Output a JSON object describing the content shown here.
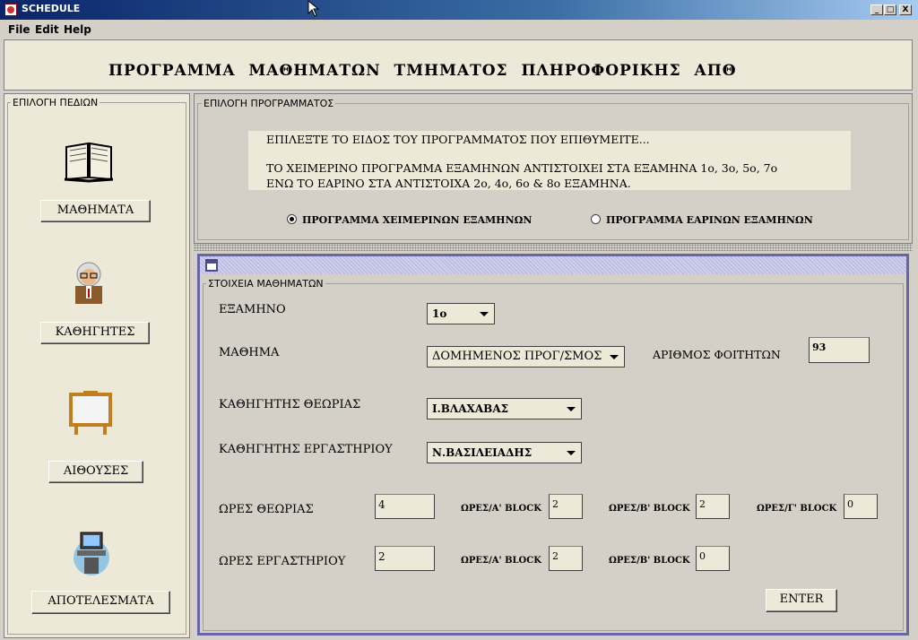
{
  "window": {
    "title": "SCHEDULE",
    "controls": [
      "_",
      "□",
      "X"
    ]
  },
  "menu": [
    "File",
    "Edit",
    "Help"
  ],
  "header": {
    "title": "ΠΡΟΓΡΑΜΜΑ ΜΑΘΗΜΑΤΩΝ ΤΜΗΜΑΤΟΣ ΠΛΗΡΟΦΟΡΙΚΗΣ ΑΠΘ"
  },
  "sidebar": {
    "legend": "ΕΠΙΛΟΓΗ ΠΕΔΙΩΝ",
    "buttons": [
      {
        "label": "ΜΑΘΗΜΑΤΑ",
        "icon": "book-icon"
      },
      {
        "label": "ΚΑΘΗΓΗΤΕΣ",
        "icon": "professor-icon"
      },
      {
        "label": "ΑΙΘΟΥΣΕΣ",
        "icon": "classroom-board-icon"
      },
      {
        "label": "ΑΠΟΤΕΛΕΣΜΑΤΑ",
        "icon": "computer-icon"
      }
    ]
  },
  "program": {
    "legend": "ΕΠΙΛΟΓΗ ΠΡΟΓΡΑΜΜΑΤΟΣ",
    "info_line1": "ΕΠΙΛΕΞΤΕ ΤΟ ΕΙΔΟΣ ΤΟΥ ΠΡΟΓΡΑΜΜΑΤΟΣ ΠΟΥ ΕΠΙΘΥΜΕΙΤΕ...",
    "info_line2": "ΤΟ ΧΕΙΜΕΡΙΝΟ ΠΡΟΓΡΑΜΜΑ ΕΞΑΜΗΝΩΝ ΑΝΤΙΣΤΟΙΧΕΙ ΣΤΑ ΕΞΑΜΗΝΑ 1ο, 3ο, 5ο, 7ο",
    "info_line3": "ΕΝΩ ΤΟ ΕΑΡΙΝΟ ΣΤΑ ΑΝΤΙΣΤΟΙΧΑ 2ο, 4ο, 6ο & 8ο ΕΞΑΜΗΝΑ.",
    "radio_winter": "ΠΡΟΓΡΑΜΜΑ ΧΕΙΜΕΡΙΝΩΝ ΕΞΑΜΗΝΩΝ",
    "radio_spring": "ΠΡΟΓΡΑΜΜΑ ΕΑΡΙΝΩΝ ΕΞΑΜΗΝΩΝ",
    "selected": "winter"
  },
  "course": {
    "legend": "ΣΤΟΙΧΕΙΑ ΜΑΘΗΜΑΤΩΝ",
    "semester_label": "ΕΞΑΜΗΝΟ",
    "semester_value": "1ο",
    "course_label": "ΜΑΘΗΜΑ",
    "course_value": "ΔΟΜΗΜΕΝΟΣ ΠΡΟΓ/ΣΜΟΣ",
    "students_label": "ΑΡΙΘΜΟΣ ΦΟΙΤΗΤΩΝ",
    "students_value": "93",
    "theory_prof_label": "ΚΑΘΗΓΗΤΗΣ ΘΕΩΡΙΑΣ",
    "theory_prof_value": "Ι.ΒΛΑΧΑΒΑΣ",
    "lab_prof_label": "ΚΑΘΗΓΗΤΗΣ ΕΡΓΑΣΤΗΡΙΟΥ",
    "lab_prof_value": "Ν.ΒΑΣΙΛΕΙΑΔΗΣ",
    "theory_hours_label": "ΩΡΕΣ ΘΕΩΡΙΑΣ",
    "theory_hours_value": "4",
    "lab_hours_label": "ΩΡΕΣ ΕΡΓΑΣΤΗΡΙΟΥ",
    "lab_hours_value": "2",
    "block_a_label": "ΩΡΕΣ/Α' BLOCK",
    "block_b_label": "ΩΡΕΣ/Β' BLOCK",
    "block_c_label": "ΩΡΕΣ/Γ' BLOCK",
    "theory_block_a": "2",
    "theory_block_b": "2",
    "theory_block_c": "0",
    "lab_block_a": "2",
    "lab_block_b": "0",
    "enter_label": "ENTER"
  }
}
